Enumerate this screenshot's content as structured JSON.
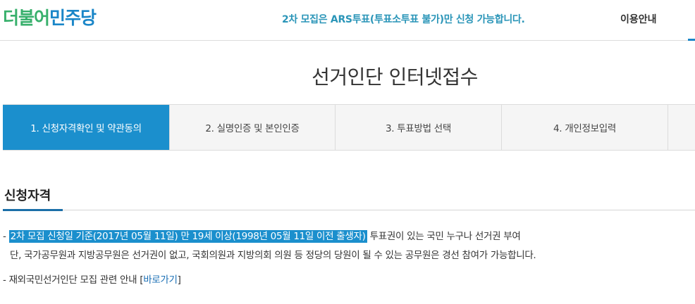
{
  "header": {
    "logo_part1": "더불어",
    "logo_part2": "민주당",
    "notice": "2차 모집은 ARS투표(투표소투표 불가)만 신청 가능합니다.",
    "guide_label": "이용안내"
  },
  "page_title": "선거인단 인터넷접수",
  "steps": [
    {
      "label": "1. 신청자격확인 및 약관동의",
      "active": true
    },
    {
      "label": "2. 실명인증 및 본인인증",
      "active": false
    },
    {
      "label": "3. 투표방법 선택",
      "active": false
    },
    {
      "label": "4. 개인정보입력",
      "active": false
    }
  ],
  "section": {
    "title": "신청자격",
    "line1_prefix": "- ",
    "line1_highlight": "2차 모집 신청일 기준(2017년 05월 11일) 만 19세 이상(1998년 05월 11일 이전 출생자)",
    "line1_rest": " 투표권이 있는 국민 누구나 선거권 부여",
    "line2": "단, 국가공무원과 지방공무원은 선거권이 없고, 국회의원과 지방의회 의원 등 정당의 당원이 될 수 있는 공무원은 경선 참여가 가능합니다.",
    "line3_prefix": "- 재외국민선거인단 모집 관련 안내 [",
    "line3_link": "바로가기",
    "line3_suffix": "]"
  },
  "colors": {
    "accent": "#1b8fcd",
    "logo_green": "#38b06c",
    "logo_blue": "#1a86c8",
    "notice": "#2a95b8"
  }
}
